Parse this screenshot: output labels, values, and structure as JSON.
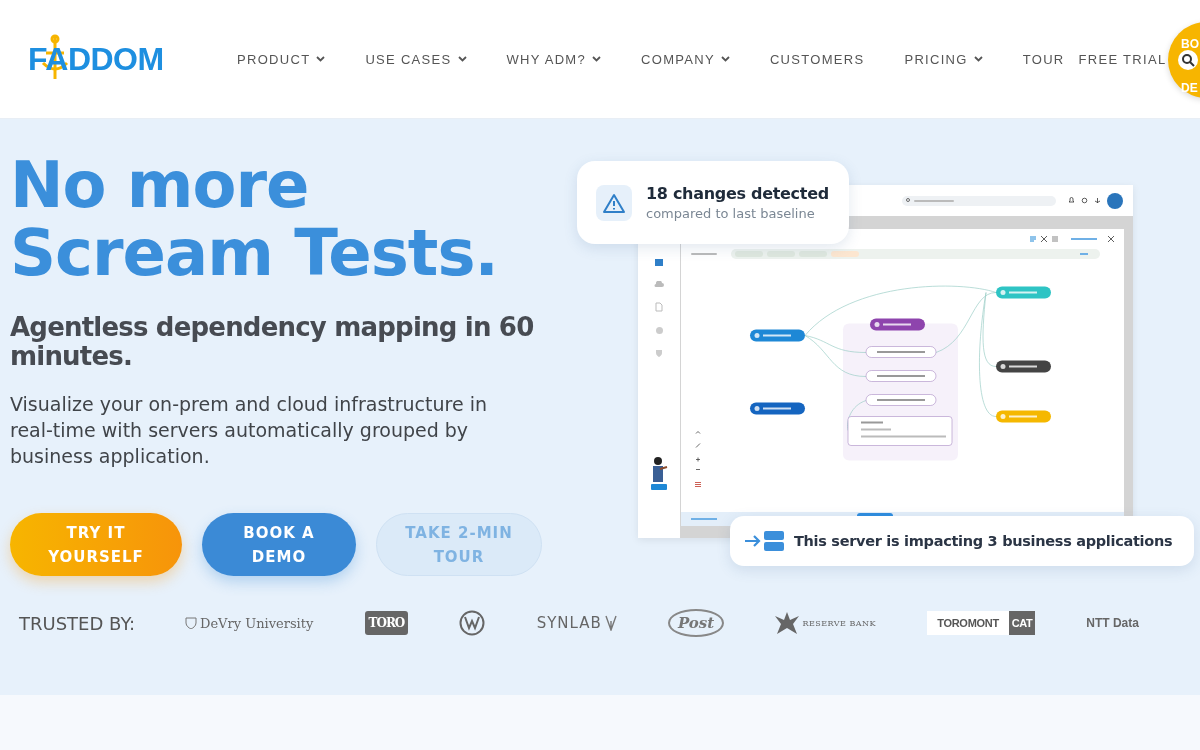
{
  "header": {
    "logo": "FADDOM",
    "nav": [
      {
        "label": "PRODUCT",
        "dropdown": true
      },
      {
        "label": "USE CASES",
        "dropdown": true
      },
      {
        "label": "WHY ADM?",
        "dropdown": true
      },
      {
        "label": "COMPANY",
        "dropdown": true
      },
      {
        "label": "CUSTOMERS",
        "dropdown": false
      },
      {
        "label": "PRICING",
        "dropdown": true
      },
      {
        "label": "TOUR",
        "dropdown": false
      },
      {
        "label": "FREE TRIAL",
        "dropdown": false
      }
    ],
    "cta": {
      "line_1": "BO",
      "line_2": "DE"
    }
  },
  "hero": {
    "title_lines": [
      "No more",
      "Scream Tests."
    ],
    "subtitle": "Agentless dependency mapping in 60 minutes.",
    "description": "Visualize your on-prem and cloud infrastructure in real-time with servers automatically grouped by business application.",
    "buttons": [
      {
        "label": "TRY IT YOURSELF",
        "kind": "primary"
      },
      {
        "label": "BOOK A DEMO",
        "kind": "secondary"
      },
      {
        "label": "TAKE 2-MIN TOUR",
        "kind": "ghost"
      }
    ]
  },
  "changes_card": {
    "title": "18 changes detected",
    "subtitle": "compared to last baseline"
  },
  "impact_card": {
    "text": "This server is impacting 3 business applications"
  },
  "app_preview": {
    "groups": [
      {
        "color": "#1e88d6"
      },
      {
        "color": "#8e44ad"
      },
      {
        "color": "#1565c0"
      },
      {
        "color": "#2ec4c4"
      },
      {
        "color": "#444444"
      },
      {
        "color": "#f5b800"
      }
    ]
  },
  "trusted": {
    "label": "TRUSTED BY:",
    "logos": [
      {
        "kind": "shield",
        "text": "DeVry University"
      },
      {
        "kind": "dark_box",
        "text": "TORO"
      },
      {
        "kind": "circle"
      },
      {
        "kind": "wordmark",
        "text": "SYNLAB"
      },
      {
        "kind": "oval",
        "text": "Post"
      },
      {
        "kind": "bank",
        "text": "RESERVE BANK"
      },
      {
        "kind": "pair",
        "text": "TOROMONT",
        "text_2": "CAT"
      },
      {
        "kind": "plain",
        "text": "NTT Data"
      }
    ]
  }
}
